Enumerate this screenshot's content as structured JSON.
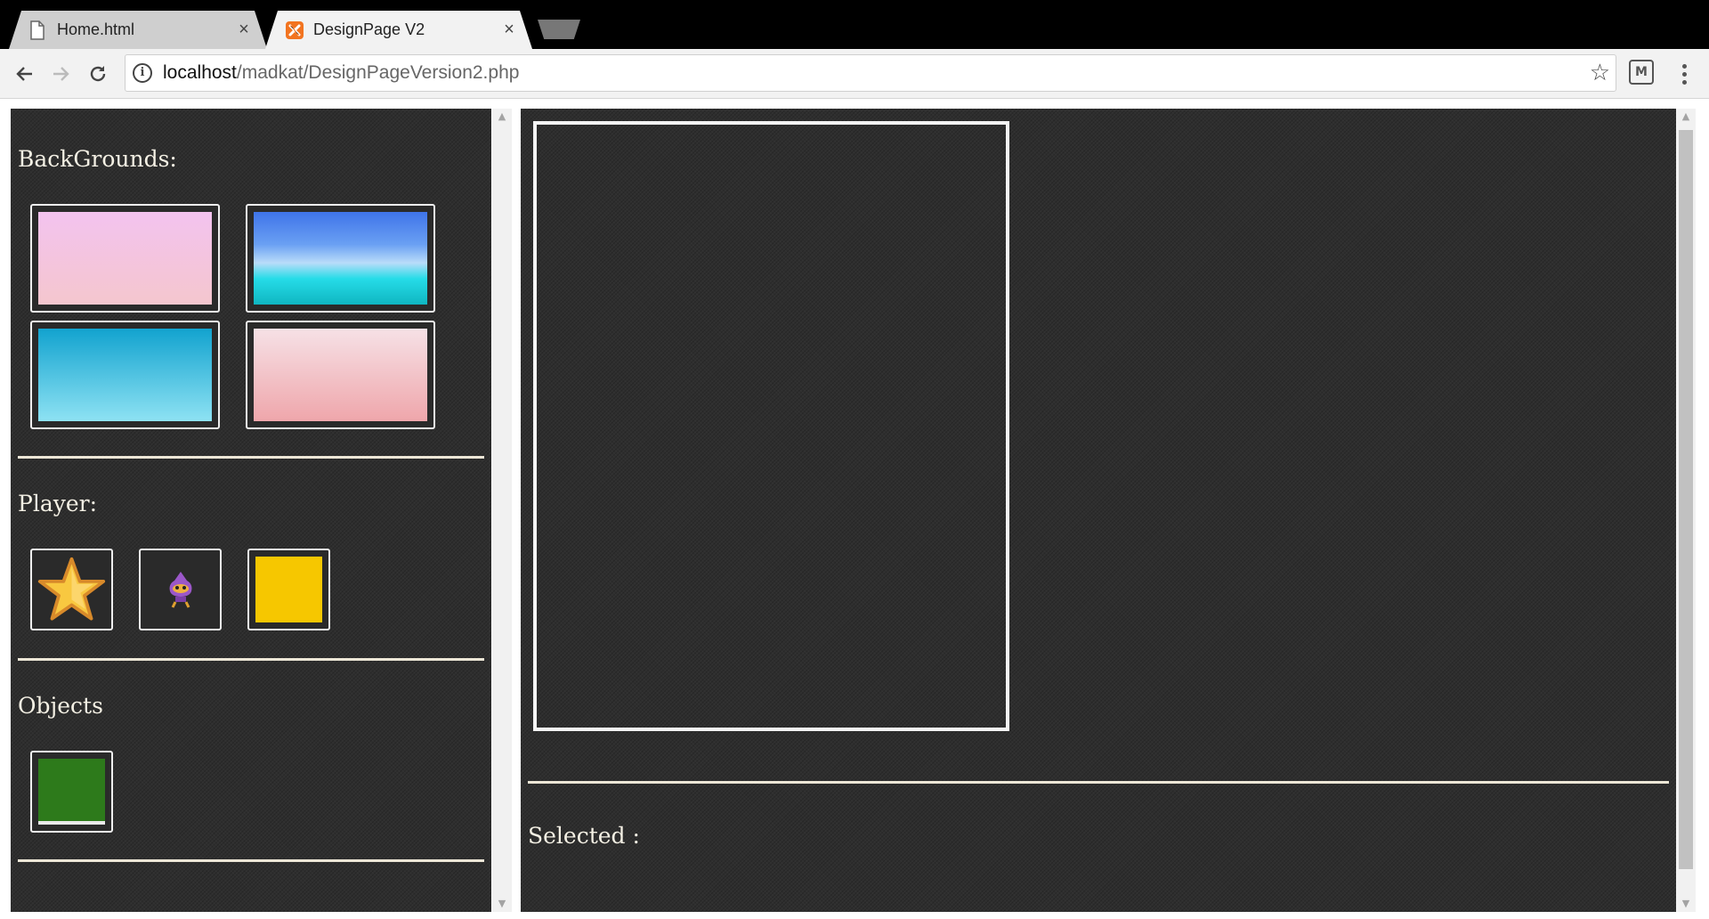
{
  "browser": {
    "tabs": [
      {
        "title": "Home.html",
        "active": false,
        "icon": "file-icon"
      },
      {
        "title": "DesignPage V2",
        "active": true,
        "icon": "xampp-icon"
      }
    ],
    "close_glyph": "×",
    "address": {
      "host": "localhost",
      "path": "/madkat/DesignPageVersion2.php"
    }
  },
  "left_panel": {
    "backgrounds": {
      "title": "BackGrounds:",
      "items": [
        {
          "name": "pink-gradient",
          "colors": [
            "#f3c3ef",
            "#f4c6ce"
          ]
        },
        {
          "name": "blue-sky-gradient",
          "colors": [
            "#3f74e9",
            "#8cc1f7",
            "#26dce8",
            "#0fb6c1"
          ]
        },
        {
          "name": "cyan-gradient",
          "colors": [
            "#12a3cf",
            "#8ee2f3"
          ]
        },
        {
          "name": "rose-gradient",
          "colors": [
            "#f6e1e6",
            "#efa6ab"
          ]
        }
      ]
    },
    "player": {
      "title": "Player:",
      "items": [
        {
          "name": "star-player",
          "icon": "star-icon"
        },
        {
          "name": "purple-character-player",
          "icon": "character-icon"
        },
        {
          "name": "yellow-block-player",
          "color": "#f6c700"
        }
      ]
    },
    "objects": {
      "title": "Objects",
      "items": [
        {
          "name": "green-block-object",
          "color": "#2d7a1b"
        }
      ]
    }
  },
  "right_panel": {
    "selected_label": "Selected :"
  },
  "colors": {
    "panel_bg": "#2e2e2e",
    "text": "#f4f0e4",
    "divider": "#ece6d6"
  }
}
